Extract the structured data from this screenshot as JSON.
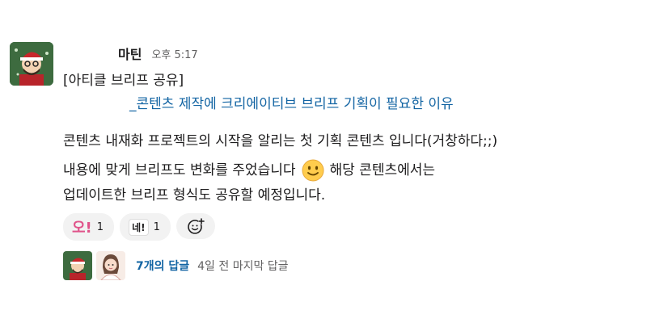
{
  "message": {
    "author": "마틴",
    "time": "오후 5:17",
    "line1": "[아티클 브리프 공유]",
    "link": "_콘텐츠 제작에 크리에이티브 브리프 기획이 필요한 이유",
    "body_line1": "콘텐츠 내재화 프로젝트의 시작을 알리는 첫 기획 콘텐츠 입니다(거창하다;;)",
    "body_line2a": "내용에 맞게 브리프도 변화를 주었습니다",
    "body_line2b": "해당 콘텐츠에서는",
    "body_line3": "업데이트한 브리프 형식도 공유할 예정입니다."
  },
  "reactions": [
    {
      "icon": "오!",
      "count": "1"
    },
    {
      "icon": "네!",
      "count": "1"
    }
  ],
  "thread": {
    "reply_count": "7개의 답글",
    "last_reply": "4일 전 마지막 답글"
  },
  "colors": {
    "link": "#1264a3",
    "muted": "#616061",
    "reaction_bg": "#f2f2f2",
    "pink": "#e0538a"
  }
}
